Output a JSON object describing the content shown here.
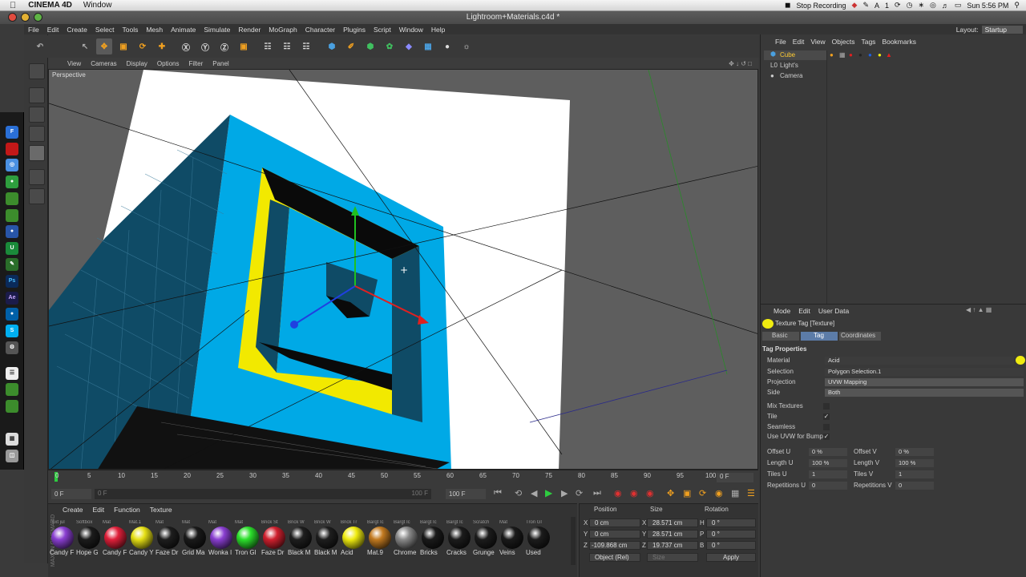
{
  "macbar": {
    "app": "CINEMA 4D",
    "menu": "Window",
    "stop_recording": "Stop Recording",
    "time": "Sun 5:56 PM"
  },
  "window": {
    "title": "Lightroom+Materials.c4d *"
  },
  "menubar": {
    "items": [
      "File",
      "Edit",
      "Create",
      "Select",
      "Tools",
      "Mesh",
      "Animate",
      "Simulate",
      "Render",
      "MoGraph",
      "Character",
      "Plugins",
      "Script",
      "Window",
      "Help"
    ],
    "layout_label": "Layout:",
    "layout_value": "Startup"
  },
  "viewport": {
    "menu": [
      "View",
      "Cameras",
      "Display",
      "Options",
      "Filter",
      "Panel"
    ],
    "label": "Perspective"
  },
  "timeline": {
    "ticks": [
      "0",
      "5",
      "10",
      "15",
      "20",
      "25",
      "30",
      "35",
      "40",
      "45",
      "50",
      "55",
      "60",
      "65",
      "70",
      "75",
      "80",
      "85",
      "90",
      "95",
      "100"
    ],
    "frame_readout": "0 F",
    "start_field": "0 F",
    "start_field2": "0 F",
    "end_field": "100 F",
    "end_field2": "100 F"
  },
  "materials": {
    "menu": [
      "Create",
      "Edit",
      "Function",
      "Texture"
    ],
    "brand": "MAXON CINEMA 4D",
    "items": [
      {
        "label": "Candy F",
        "top": "Text jul",
        "color": "#8a3fd1"
      },
      {
        "label": "Hope G",
        "top": "Softbox",
        "color": "#1c1c1c"
      },
      {
        "label": "Candy F",
        "top": "Mat",
        "color": "#e0203a"
      },
      {
        "label": "Candy Y",
        "top": "Mat.1",
        "color": "#e6e015"
      },
      {
        "label": "Faze Dr",
        "top": "Mat",
        "color": "#1e1e1e"
      },
      {
        "label": "Grid Ma",
        "top": "Mat",
        "color": "#1a1a1a"
      },
      {
        "label": "Wonka I",
        "top": "Mat",
        "color": "#8a3fd1"
      },
      {
        "label": "Tron Gl",
        "top": "Mat",
        "color": "#2ce02c"
      },
      {
        "label": "Faze Dr",
        "top": "Brick St",
        "color": "#d0202e"
      },
      {
        "label": "Black M",
        "top": "Brick W",
        "color": "#1e1e1e"
      },
      {
        "label": "Black M",
        "top": "Brick W",
        "color": "#1e1e1e"
      },
      {
        "label": "Acid",
        "top": "Brick Tr",
        "color": "#f0ec10"
      },
      {
        "label": "Mat.9",
        "top": "Bargt Ic",
        "color": "#c27a20"
      },
      {
        "label": "Chrome",
        "top": "Bargt Ic",
        "color": "#8a8a8a"
      },
      {
        "label": "Bricks",
        "top": "Bargt Ic",
        "color": "#1a1a1a"
      },
      {
        "label": "Cracks",
        "top": "Bargt Ic",
        "color": "#1c1c1c"
      },
      {
        "label": "Grunge",
        "top": "Scratch",
        "color": "#1c1c1c"
      },
      {
        "label": "Veins",
        "top": "Mat",
        "color": "#1a1a1a"
      },
      {
        "label": "Used",
        "top": "Tron Gl",
        "color": "#1c1c1c"
      }
    ]
  },
  "coords": {
    "headers": {
      "position": "Position",
      "size": "Size",
      "rotation": "Rotation"
    },
    "axis_pos": [
      "X",
      "Y",
      "Z"
    ],
    "axis_size": [
      "X",
      "Y",
      "Z"
    ],
    "axis_rot": [
      "H",
      "P",
      "B"
    ],
    "position": [
      "0 cm",
      "0 cm",
      "-109.868 cm"
    ],
    "size": [
      "28.571 cm",
      "28.571 cm",
      "19.737 cm"
    ],
    "rotation": [
      "0 °",
      "0 °",
      "0 °"
    ],
    "mode": "Object (Rel)",
    "size_mode": "Size",
    "apply": "Apply"
  },
  "objects": {
    "menu": [
      "File",
      "Edit",
      "View",
      "Objects",
      "Tags",
      "Bookmarks"
    ],
    "items": [
      {
        "name": "Cube",
        "color": "#ffcc33"
      },
      {
        "name": "Light's",
        "color": "#cccccc"
      },
      {
        "name": "Camera",
        "color": "#cccccc"
      }
    ]
  },
  "attributes": {
    "menu": [
      "Mode",
      "Edit",
      "User Data"
    ],
    "title": "Texture Tag [Texture]",
    "tabs": [
      "Basic",
      "Tag",
      "Coordinates"
    ],
    "section": "Tag Properties",
    "material_label": "Material",
    "material_value": "Acid",
    "selection_label": "Selection",
    "selection_value": "Polygon Selection.1",
    "projection_label": "Projection",
    "projection_value": "UVW Mapping",
    "side_label": "Side",
    "side_value": "Both",
    "mix_label": "Mix Textures",
    "tile_label": "Tile",
    "seamless_label": "Seamless",
    "uvwbump_label": "Use UVW for Bump",
    "check": "✓",
    "offset_u_label": "Offset U",
    "offset_u": "0 %",
    "offset_v_label": "Offset V",
    "offset_v": "0 %",
    "length_u_label": "Length U",
    "length_u": "100 %",
    "length_v_label": "Length V",
    "length_v": "100 %",
    "tiles_u_label": "Tiles U",
    "tiles_u": "1",
    "tiles_v_label": "Tiles V",
    "tiles_v": "1",
    "rep_u_label": "Repetitions U",
    "rep_u": "0",
    "rep_v_label": "Repetitions V",
    "rep_v": "0"
  }
}
